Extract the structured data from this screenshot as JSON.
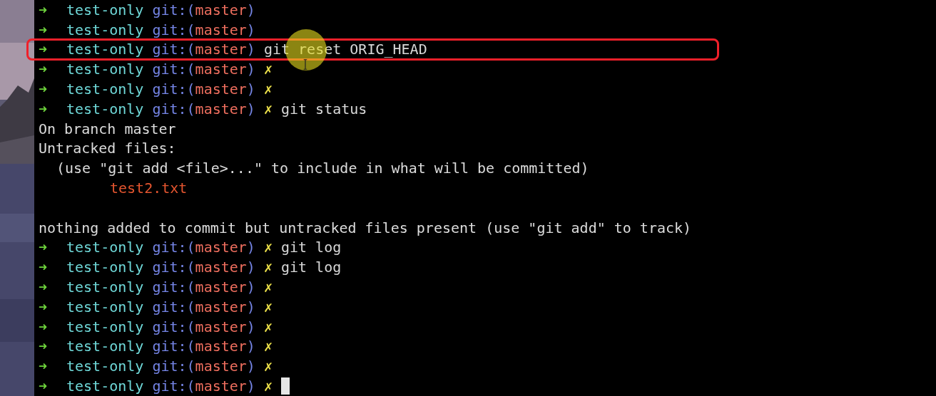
{
  "terminal": {
    "lines": [
      {
        "kind": "prompt",
        "arrow": "➜",
        "dir": "test-only",
        "git_prefix": "git:(",
        "branch": "master",
        "git_suffix": ")"
      },
      {
        "kind": "prompt",
        "arrow": "➜",
        "dir": "test-only",
        "git_prefix": "git:(",
        "branch": "master",
        "git_suffix": ")"
      },
      {
        "kind": "prompt",
        "arrow": "➜",
        "dir": "test-only",
        "git_prefix": "git:(",
        "branch": "master",
        "git_suffix": ")",
        "command": "git reset ORIG_HEAD"
      },
      {
        "kind": "prompt",
        "arrow": "➜",
        "dir": "test-only",
        "git_prefix": "git:(",
        "branch": "master",
        "git_suffix": ")",
        "dirty_mark": "✗"
      },
      {
        "kind": "prompt",
        "arrow": "➜",
        "dir": "test-only",
        "git_prefix": "git:(",
        "branch": "master",
        "git_suffix": ")",
        "dirty_mark": "✗"
      },
      {
        "kind": "prompt",
        "arrow": "➜",
        "dir": "test-only",
        "git_prefix": "git:(",
        "branch": "master",
        "git_suffix": ")",
        "dirty_mark": "✗",
        "command": "git status"
      },
      {
        "kind": "output",
        "text": "On branch master"
      },
      {
        "kind": "output",
        "text": "Untracked files:"
      },
      {
        "kind": "hint",
        "text": "(use \"git add <file>...\" to include in what will be committed)"
      },
      {
        "kind": "untracked",
        "text": "test2.txt"
      },
      {
        "kind": "blank"
      },
      {
        "kind": "output",
        "text": "nothing added to commit but untracked files present (use \"git add\" to track)"
      },
      {
        "kind": "prompt",
        "arrow": "➜",
        "dir": "test-only",
        "git_prefix": "git:(",
        "branch": "master",
        "git_suffix": ")",
        "dirty_mark": "✗",
        "command": "git log"
      },
      {
        "kind": "prompt",
        "arrow": "➜",
        "dir": "test-only",
        "git_prefix": "git:(",
        "branch": "master",
        "git_suffix": ")",
        "dirty_mark": "✗",
        "command": "git log"
      },
      {
        "kind": "prompt",
        "arrow": "➜",
        "dir": "test-only",
        "git_prefix": "git:(",
        "branch": "master",
        "git_suffix": ")",
        "dirty_mark": "✗"
      },
      {
        "kind": "prompt",
        "arrow": "➜",
        "dir": "test-only",
        "git_prefix": "git:(",
        "branch": "master",
        "git_suffix": ")",
        "dirty_mark": "✗"
      },
      {
        "kind": "prompt",
        "arrow": "➜",
        "dir": "test-only",
        "git_prefix": "git:(",
        "branch": "master",
        "git_suffix": ")",
        "dirty_mark": "✗"
      },
      {
        "kind": "prompt",
        "arrow": "➜",
        "dir": "test-only",
        "git_prefix": "git:(",
        "branch": "master",
        "git_suffix": ")",
        "dirty_mark": "✗"
      },
      {
        "kind": "prompt",
        "arrow": "➜",
        "dir": "test-only",
        "git_prefix": "git:(",
        "branch": "master",
        "git_suffix": ")",
        "dirty_mark": "✗"
      },
      {
        "kind": "prompt",
        "arrow": "➜",
        "dir": "test-only",
        "git_prefix": "git:(",
        "branch": "master",
        "git_suffix": ")",
        "dirty_mark": "✗",
        "cursor": true
      }
    ]
  }
}
